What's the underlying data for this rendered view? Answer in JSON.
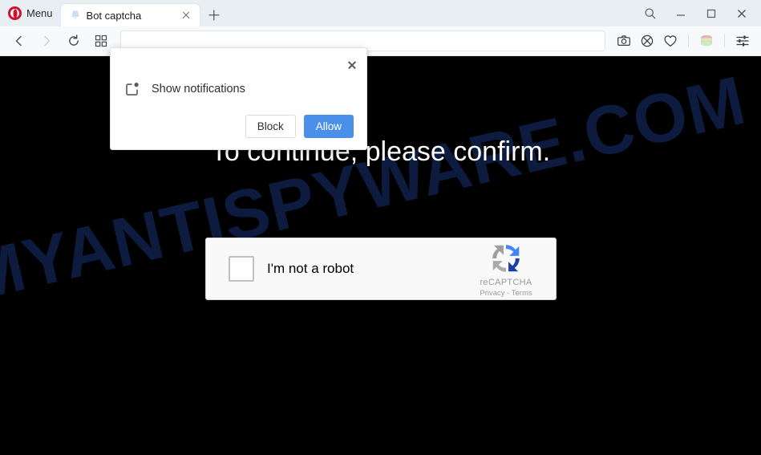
{
  "browser": {
    "menu_label": "Menu",
    "tab": {
      "title": "Bot captcha",
      "favicon": "bell-favicon",
      "close": "×"
    },
    "new_tab": "+",
    "window_controls": {
      "search": "search-icon",
      "minimize": "minimize-icon",
      "maximize": "maximize-icon",
      "close": "close-icon"
    },
    "toolbar": {
      "back": "back-arrow-icon",
      "forward": "forward-arrow-icon",
      "reload": "reload-icon",
      "tab_overview": "grid-icon",
      "address_value": "",
      "address_placeholder": "",
      "right_icons": {
        "snapshot": "camera-icon",
        "adblock": "shield-block-icon",
        "favorites": "heart-icon",
        "workspaces": "stack-icon",
        "easy_setup": "sliders-icon"
      }
    }
  },
  "dialog": {
    "title": "Show notifications",
    "icon": "notification-permission-icon",
    "close_label": "×",
    "block_label": "Block",
    "allow_label": "Allow",
    "allow_color": "#4a90e8"
  },
  "page": {
    "watermark": "MYANTISPYWARE.COM",
    "watermark_color": "#0d1b3e",
    "background_color": "#000000",
    "headline": "To continue, please confirm.",
    "headline_color": "#ffffff",
    "recaptcha": {
      "checkbox_label": "I'm not a robot",
      "brand": "reCAPTCHA",
      "terms": "Privacy - Terms",
      "logo": "recaptcha-logo"
    }
  }
}
